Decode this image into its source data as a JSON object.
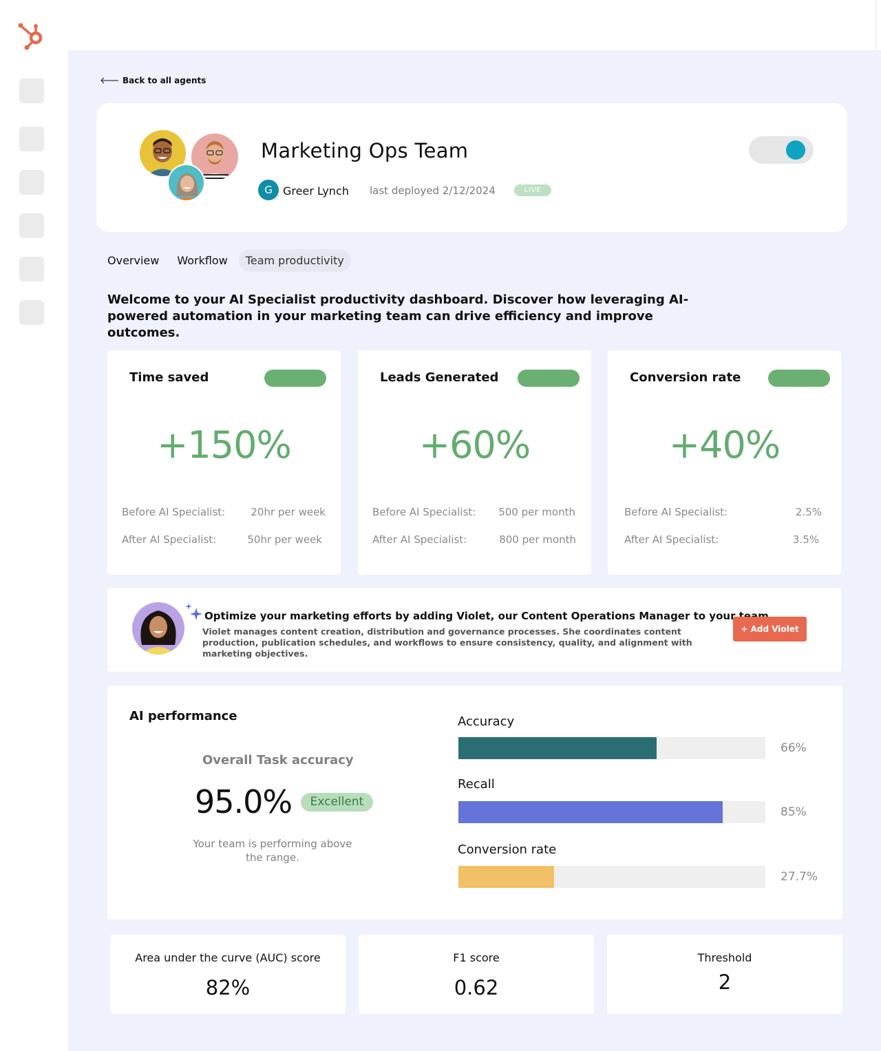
{
  "back_link": "Back to all agents",
  "header": {
    "title": "Marketing Ops Team",
    "owner_initial": "G",
    "owner_name": "Greer Lynch",
    "deployed": "last deployed 2/12/2024",
    "status": "LIVE"
  },
  "tabs": [
    "Overview",
    "Workflow",
    "Team productivity"
  ],
  "intro": "Welcome to your AI Specialist productivity dashboard. Discover how leveraging AI-powered automation in your marketing team can drive efficiency and improve outcomes.",
  "metrics": [
    {
      "title": "Time saved",
      "value": "+150%",
      "before_label": "Before AI Specialist:",
      "before_value": "20hr per week",
      "after_label": "After AI Specialist:",
      "after_value": "50hr per week"
    },
    {
      "title": "Leads Generated",
      "value": "+60%",
      "before_label": "Before AI Specialist:",
      "before_value": "500 per month",
      "after_label": "After AI Specialist:",
      "after_value": "800 per month"
    },
    {
      "title": "Conversion rate",
      "value": "+40%",
      "before_label": "Before AI Specialist:",
      "before_value": "2.5%",
      "after_label": "After AI Specialist:",
      "after_value": "3.5%"
    }
  ],
  "promo": {
    "title": "Optimize your marketing efforts by adding Violet, our Content Operations Manager to your team",
    "description": "Violet manages content creation, distribution and governance processes. She coordinates content production, publication schedules, and workflows to ensure consistency, quality, and alignment with marketing objectives.",
    "button": "+ Add Violet"
  },
  "performance": {
    "title": "AI performance",
    "overall_label": "Overall Task accuracy",
    "overall_value": "95.0%",
    "rating": "Excellent",
    "note": "Your team is performing above the range.",
    "bars": [
      {
        "label": "Accuracy",
        "pct_text": "66%",
        "fill": 0.646,
        "color": "#2a6e74"
      },
      {
        "label": "Recall",
        "pct_text": "85%",
        "fill": 0.862,
        "color": "#6474d8"
      },
      {
        "label": "Conversion rate",
        "pct_text": "27.7%",
        "fill": 0.312,
        "color": "#f2c066"
      }
    ]
  },
  "stats": [
    {
      "label": "Area under the curve (AUC) score",
      "value": "82%"
    },
    {
      "label": "F1 score",
      "value": "0.62"
    },
    {
      "label": "Threshold",
      "value": "2"
    }
  ],
  "colors": {
    "brand": "#e8694f",
    "accent": "#0ea3c2",
    "positive": "#62ac6e"
  }
}
